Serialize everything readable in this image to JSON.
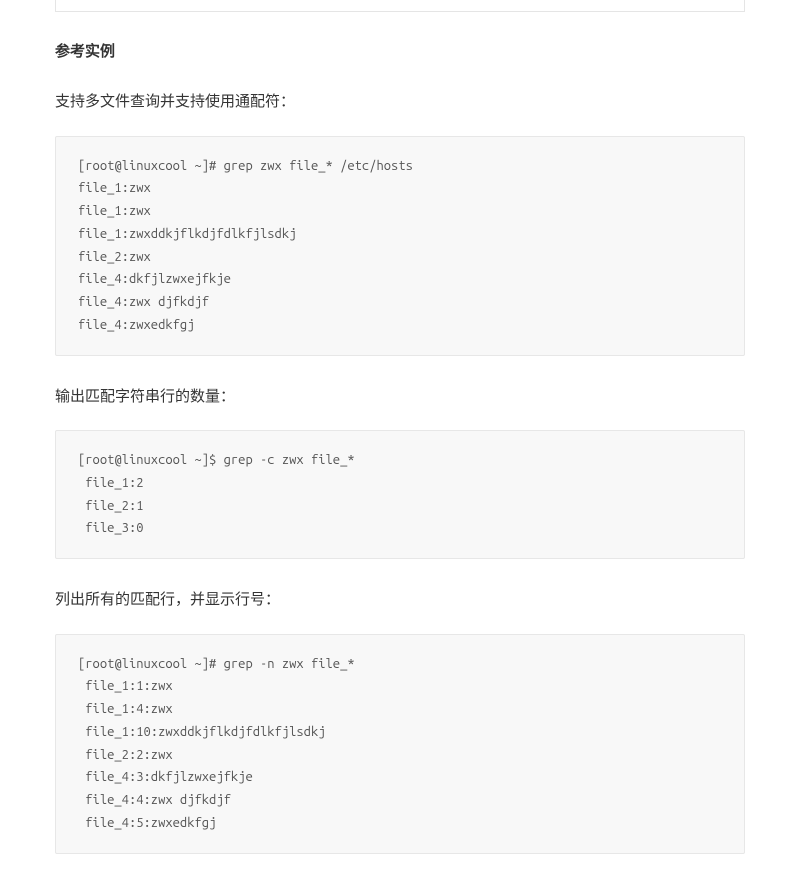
{
  "section_title": "参考实例",
  "blocks": [
    {
      "desc": "支持多文件查询并支持使用通配符：",
      "code": "[root@linuxcool ~]# grep zwx file_* /etc/hosts\nfile_1:zwx\nfile_1:zwx\nfile_1:zwxddkjflkdjfdlkfjlsdkj\nfile_2:zwx\nfile_4:dkfjlzwxejfkje\nfile_4:zwx djfkdjf\nfile_4:zwxedkfgj"
    },
    {
      "desc": "输出匹配字符串行的数量：",
      "code": "[root@linuxcool ~]$ grep -c zwx file_*\n file_1:2\n file_2:1\n file_3:0"
    },
    {
      "desc": "列出所有的匹配行，并显示行号：",
      "code": "[root@linuxcool ~]# grep -n zwx file_*\n file_1:1:zwx\n file_1:4:zwx\n file_1:10:zwxddkjflkdjfdlkfjlsdkj\n file_2:2:zwx\n file_4:3:dkfjlzwxejfkje\n file_4:4:zwx djfkdjf\n file_4:5:zwxedkfgj"
    }
  ]
}
